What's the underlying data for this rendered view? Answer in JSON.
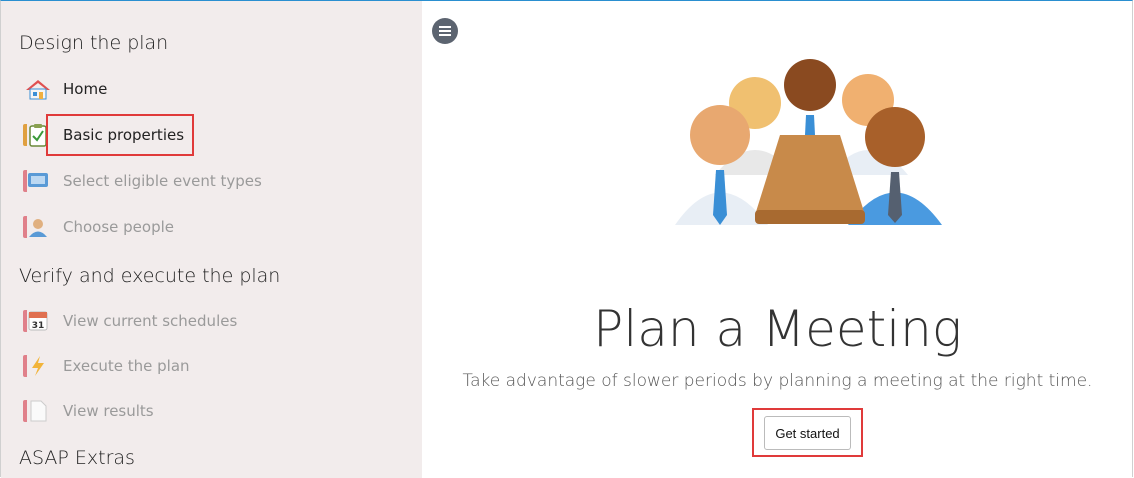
{
  "sidebar": {
    "sections": [
      {
        "title": "Design the plan"
      },
      {
        "title": "Verify and execute the plan"
      },
      {
        "title": "ASAP Extras"
      }
    ],
    "items": [
      {
        "label": "Home",
        "icon": "home-icon",
        "state": "enabled"
      },
      {
        "label": "Basic properties",
        "icon": "clipboard-check-icon",
        "state": "enabled",
        "highlighted": true
      },
      {
        "label": "Select eligible event types",
        "icon": "monitor-icon",
        "state": "disabled"
      },
      {
        "label": "Choose people",
        "icon": "person-icon",
        "state": "disabled"
      },
      {
        "label": "View current schedules",
        "icon": "calendar-icon",
        "state": "disabled",
        "calendar_day": "31"
      },
      {
        "label": "Execute the plan",
        "icon": "lightning-icon",
        "state": "disabled"
      },
      {
        "label": "View results",
        "icon": "document-icon",
        "state": "disabled"
      }
    ]
  },
  "main": {
    "menu_icon": "menu-icon",
    "illustration": "meeting-people-illustration",
    "title": "Plan a Meeting",
    "subtitle": "Take advantage of slower periods by planning a meeting at the right time.",
    "cta_label": "Get started",
    "cta_highlighted": true
  },
  "colors": {
    "sidebar_bg": "#f2ecec",
    "highlight_border": "#e03a3a",
    "accent_bar": "#e0808a",
    "top_border": "#2a8fd0"
  }
}
